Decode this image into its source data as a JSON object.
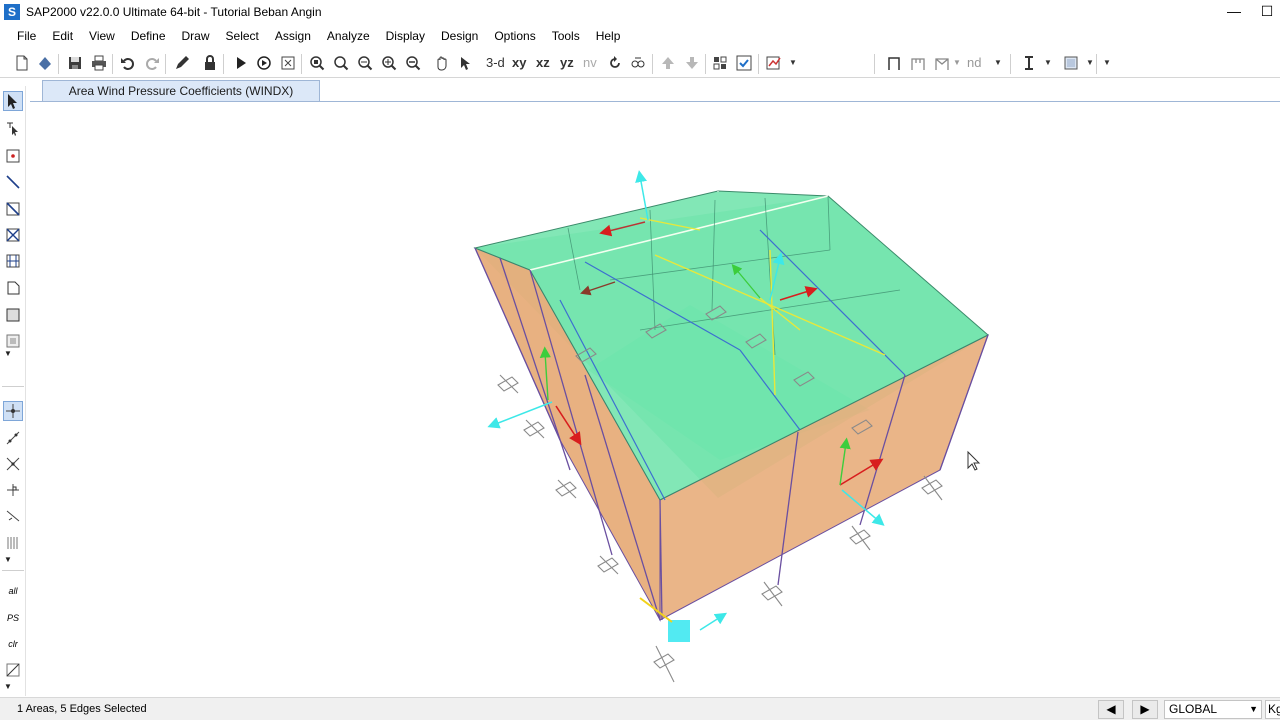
{
  "window": {
    "title": "SAP2000 v22.0.0 Ultimate 64-bit - Tutorial Beban Angin",
    "app_icon_letter": "S",
    "minimize_glyph": "—",
    "maximize_glyph": "☐"
  },
  "menu": [
    "File",
    "Edit",
    "View",
    "Define",
    "Draw",
    "Select",
    "Assign",
    "Analyze",
    "Display",
    "Design",
    "Options",
    "Tools",
    "Help"
  ],
  "toolbar": {
    "view_3d": "3-d",
    "view_xy": "xy",
    "view_xz": "xz",
    "view_yz": "yz",
    "view_nv": "nv",
    "node_label": "nd"
  },
  "tab": {
    "label": "Area Wind Pressure Coefficients (WINDX)"
  },
  "left_toolbar": {
    "all_label": "all",
    "ps_label": "PS",
    "clr_label": "clr"
  },
  "status": {
    "selection": "1 Areas, 5 Edges Selected",
    "coord_system": "GLOBAL",
    "units": "Kg"
  },
  "colors": {
    "roof": "#5fe0a2",
    "wall": "#e6a873",
    "frame": "#6a4fa0",
    "accent": "#1e6fc8"
  }
}
